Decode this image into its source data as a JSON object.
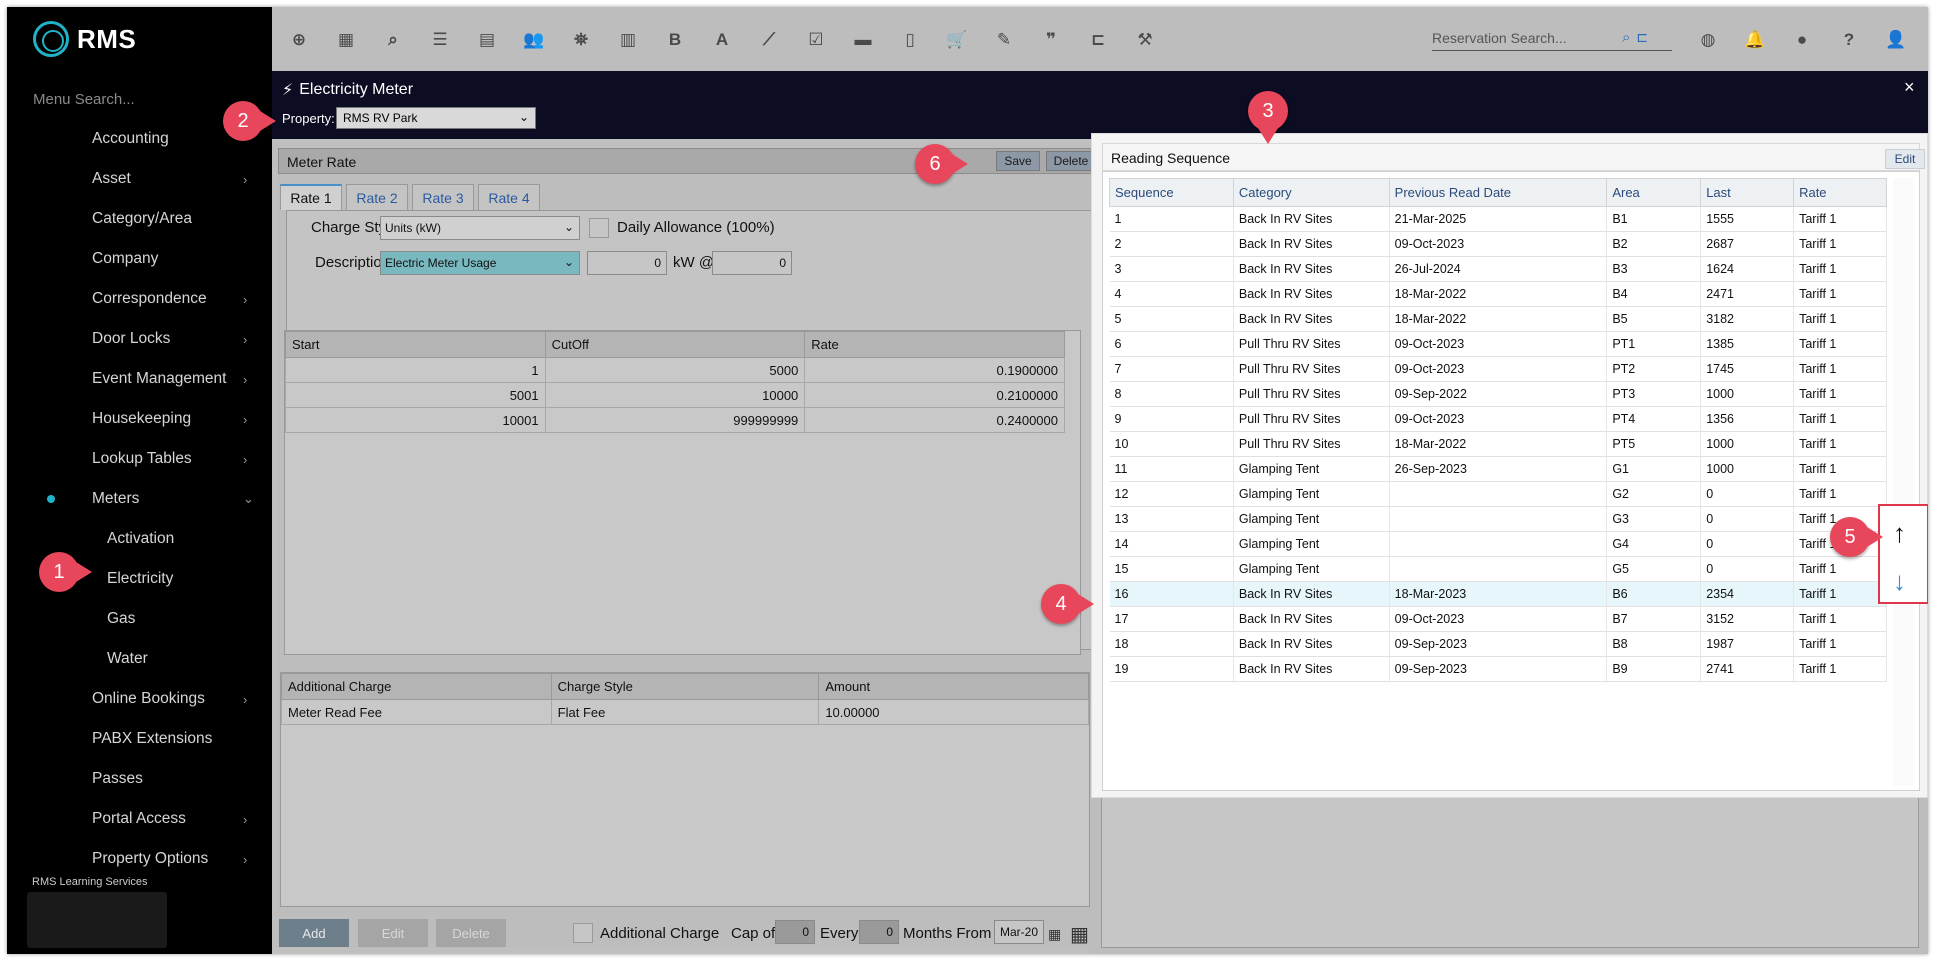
{
  "app": {
    "logo_text": "RMS",
    "learning_label": "RMS Learning Services"
  },
  "sidebar": {
    "search_placeholder": "Menu Search...",
    "items": [
      {
        "label": "Accounting",
        "chevron": false
      },
      {
        "label": "Asset",
        "chevron": true
      },
      {
        "label": "Category/Area",
        "chevron": false
      },
      {
        "label": "Company",
        "chevron": false
      },
      {
        "label": "Correspondence",
        "chevron": true
      },
      {
        "label": "Door Locks",
        "chevron": true
      },
      {
        "label": "Event Management",
        "chevron": true
      },
      {
        "label": "Housekeeping",
        "chevron": true
      },
      {
        "label": "Lookup Tables",
        "chevron": true
      },
      {
        "label": "Meters",
        "chevron": true,
        "expanded": true
      },
      {
        "label": "Activation",
        "sub": true
      },
      {
        "label": "Electricity",
        "sub": true,
        "active": true
      },
      {
        "label": "Gas",
        "sub": true
      },
      {
        "label": "Water",
        "sub": true
      },
      {
        "label": "Online Bookings",
        "chevron": true
      },
      {
        "label": "PABX Extensions",
        "chevron": false
      },
      {
        "label": "Passes",
        "chevron": false
      },
      {
        "label": "Portal Access",
        "chevron": true
      },
      {
        "label": "Property Options",
        "chevron": true
      }
    ]
  },
  "toolbar": {
    "icons": [
      "plus-circle-icon",
      "calendar-icon",
      "search-icon",
      "sliders-icon",
      "grid-icon",
      "users-icon",
      "map-pin-icon",
      "map-icon",
      "bold-icon",
      "font-icon",
      "chart-icon",
      "checklist-icon",
      "card-icon",
      "document-icon",
      "cart-icon",
      "ticket-icon",
      "quote-icon",
      "bed-icon",
      "hammer-icon"
    ],
    "reservation_search_placeholder": "Reservation Search...",
    "right_icons": [
      "globe-icon",
      "bell-icon",
      "chat-icon",
      "help-icon",
      "user-icon"
    ]
  },
  "window": {
    "title": "Electricity Meter",
    "property_label": "Property:",
    "property_value": "RMS RV Park",
    "close": "×"
  },
  "meter_rate": {
    "header": "Meter Rate",
    "save_label": "Save",
    "delete_label": "Delete",
    "tabs": [
      "Rate 1",
      "Rate 2",
      "Rate 3",
      "Rate 4"
    ],
    "charge_style_label": "Charge Style",
    "charge_style_value": "Units (kW)",
    "daily_allowance_label": "Daily Allowance (100%)",
    "description_label": "Description",
    "description_value": "Electric Meter Usage",
    "kw_value": "0",
    "kw_label": "kW @",
    "at_value": "0",
    "rates_columns": [
      "Start",
      "CutOff",
      "Rate"
    ],
    "rates_rows": [
      [
        "1",
        "5000",
        "0.1900000"
      ],
      [
        "5001",
        "10000",
        "0.2100000"
      ],
      [
        "10001",
        "999999999",
        "0.2400000"
      ]
    ],
    "additional_columns": [
      "Additional Charge",
      "Charge Style",
      "Amount"
    ],
    "additional_rows": [
      [
        "Meter Read Fee",
        "Flat Fee",
        "10.00000"
      ]
    ],
    "add_label": "Add",
    "edit_label": "Edit",
    "delete_row_label": "Delete",
    "additional_charge_label": "Additional Charge",
    "cap_of_label": "Cap of",
    "cap_value": "0",
    "every_label": "Every",
    "every_value": "0",
    "months_from_label": "Months From",
    "months_from_value": "Mar-20"
  },
  "reading_sequence": {
    "header": "Reading Sequence",
    "edit_label": "Edit",
    "columns": [
      "Sequence",
      "Category",
      "Previous Read Date",
      "Area",
      "Last",
      "Rate"
    ],
    "rows": [
      [
        "1",
        "Back In RV Sites",
        "21-Mar-2025",
        "B1",
        "1555",
        "Tariff 1"
      ],
      [
        "2",
        "Back In RV Sites",
        "09-Oct-2023",
        "B2",
        "2687",
        "Tariff 1"
      ],
      [
        "3",
        "Back In RV Sites",
        "26-Jul-2024",
        "B3",
        "1624",
        "Tariff 1"
      ],
      [
        "4",
        "Back In RV Sites",
        "18-Mar-2022",
        "B4",
        "2471",
        "Tariff 1"
      ],
      [
        "5",
        "Back In RV Sites",
        "18-Mar-2022",
        "B5",
        "3182",
        "Tariff 1"
      ],
      [
        "6",
        "Pull Thru RV Sites",
        "09-Oct-2023",
        "PT1",
        "1385",
        "Tariff 1"
      ],
      [
        "7",
        "Pull Thru RV Sites",
        "09-Oct-2023",
        "PT2",
        "1745",
        "Tariff 1"
      ],
      [
        "8",
        "Pull Thru RV Sites",
        "09-Sep-2022",
        "PT3",
        "1000",
        "Tariff 1"
      ],
      [
        "9",
        "Pull Thru RV Sites",
        "09-Oct-2023",
        "PT4",
        "1356",
        "Tariff 1"
      ],
      [
        "10",
        "Pull Thru RV Sites",
        "18-Mar-2022",
        "PT5",
        "1000",
        "Tariff 1"
      ],
      [
        "11",
        "Glamping Tent",
        "26-Sep-2023",
        "G1",
        "1000",
        "Tariff 1"
      ],
      [
        "12",
        "Glamping Tent",
        "",
        "G2",
        "0",
        "Tariff 1"
      ],
      [
        "13",
        "Glamping Tent",
        "",
        "G3",
        "0",
        "Tariff 1"
      ],
      [
        "14",
        "Glamping Tent",
        "",
        "G4",
        "0",
        "Tariff 1"
      ],
      [
        "15",
        "Glamping Tent",
        "",
        "G5",
        "0",
        "Tariff 1"
      ],
      [
        "16",
        "Back In RV Sites",
        "18-Mar-2023",
        "B6",
        "2354",
        "Tariff 1"
      ],
      [
        "17",
        "Back In RV Sites",
        "09-Oct-2023",
        "B7",
        "3152",
        "Tariff 1"
      ],
      [
        "18",
        "Back In RV Sites",
        "09-Sep-2023",
        "B8",
        "1987",
        "Tariff 1"
      ],
      [
        "19",
        "Back In RV Sites",
        "09-Sep-2023",
        "B9",
        "2741",
        "Tariff 1"
      ]
    ],
    "selected_row": 15,
    "move_up": "↑",
    "move_down": "↓"
  },
  "callouts": [
    "1",
    "2",
    "3",
    "4",
    "5",
    "6"
  ],
  "colors": {
    "accent": "#20b2c8",
    "callout": "#e8465a",
    "title_bar": "#0c0c22",
    "selected_row": "#e6f6fb"
  }
}
